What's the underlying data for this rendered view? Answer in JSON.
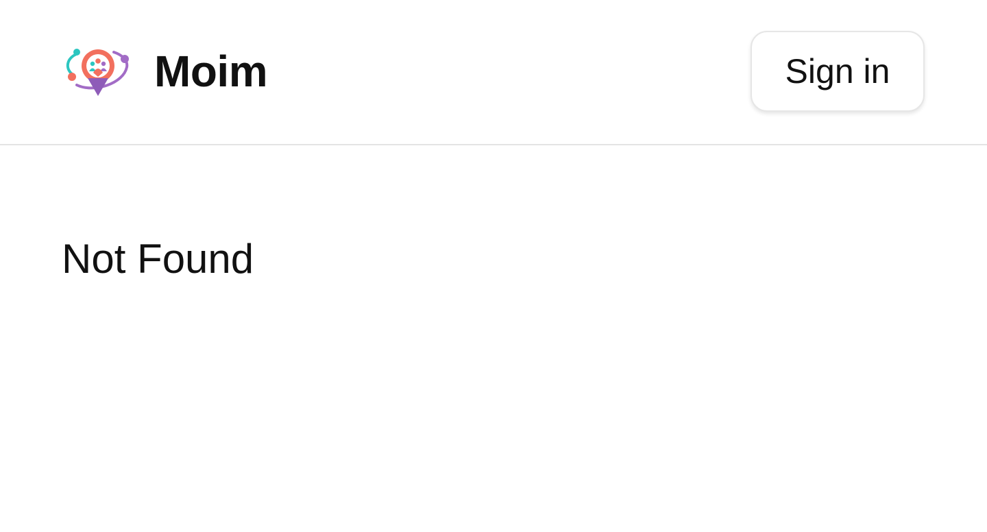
{
  "header": {
    "brand_name": "Moim",
    "logo_icon": "moim-logo-icon",
    "signin_label": "Sign in"
  },
  "main": {
    "message": "Not Found"
  },
  "colors": {
    "logo_coral": "#f2705e",
    "logo_teal": "#2cc6c0",
    "logo_purple": "#a26cc6",
    "border": "#e4e4e4",
    "text": "#111111"
  }
}
